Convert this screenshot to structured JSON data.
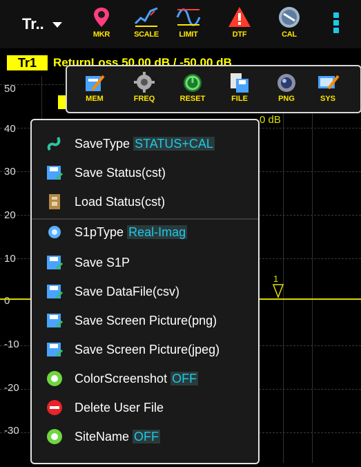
{
  "toolbar": {
    "trace_selector": "Tr..",
    "buttons": [
      {
        "label": "MKR",
        "icon": "marker-pin-icon"
      },
      {
        "label": "SCALE",
        "icon": "scale-icon"
      },
      {
        "label": "LIMIT",
        "icon": "limit-icon"
      },
      {
        "label": "DTF",
        "icon": "dtf-warning-icon"
      },
      {
        "label": "CAL",
        "icon": "cal-icon"
      }
    ],
    "more_icon": "kebab-menu-icon"
  },
  "chart": {
    "trace_tag": "Tr1",
    "trace_title": "ReturnLoss 50.00 dB / -50.00 dB",
    "y_labels": [
      "50",
      "40",
      "30",
      "20",
      "10",
      "0",
      "-10",
      "-20",
      "-30"
    ],
    "partial_value": "0 dB",
    "marker_number": "1"
  },
  "submenu": {
    "items": [
      {
        "label": "MEM",
        "icon": "memory-icon"
      },
      {
        "label": "FREQ",
        "icon": "gear-icon"
      },
      {
        "label": "RESET",
        "icon": "reset-icon"
      },
      {
        "label": "FILE",
        "icon": "file-icon"
      },
      {
        "label": "PNG",
        "icon": "camera-icon"
      },
      {
        "label": "SYS",
        "icon": "system-icon"
      }
    ]
  },
  "file_menu": {
    "items": [
      {
        "label": "SaveType",
        "value": "STATUS+CAL",
        "icon": "save-type-icon"
      },
      {
        "label": "Save Status(cst)",
        "icon": "floppy-icon"
      },
      {
        "label": "Load Status(cst)",
        "icon": "load-file-icon"
      },
      {
        "label": "S1pType",
        "value": "Real-Imag",
        "icon": "gear-blue-icon"
      },
      {
        "label": "Save S1P",
        "icon": "floppy-icon"
      },
      {
        "label": "Save DataFile(csv)",
        "icon": "floppy-icon"
      },
      {
        "label": "Save Screen Picture(png)",
        "icon": "floppy-icon"
      },
      {
        "label": "Save Screen Picture(jpeg)",
        "icon": "floppy-icon"
      },
      {
        "label": "ColorScreenshot",
        "value": "OFF",
        "icon": "toggle-green-icon"
      },
      {
        "label": "Delete User File",
        "icon": "delete-red-icon"
      },
      {
        "label": "SiteName",
        "value": "OFF",
        "icon": "toggle-green-icon"
      }
    ]
  }
}
